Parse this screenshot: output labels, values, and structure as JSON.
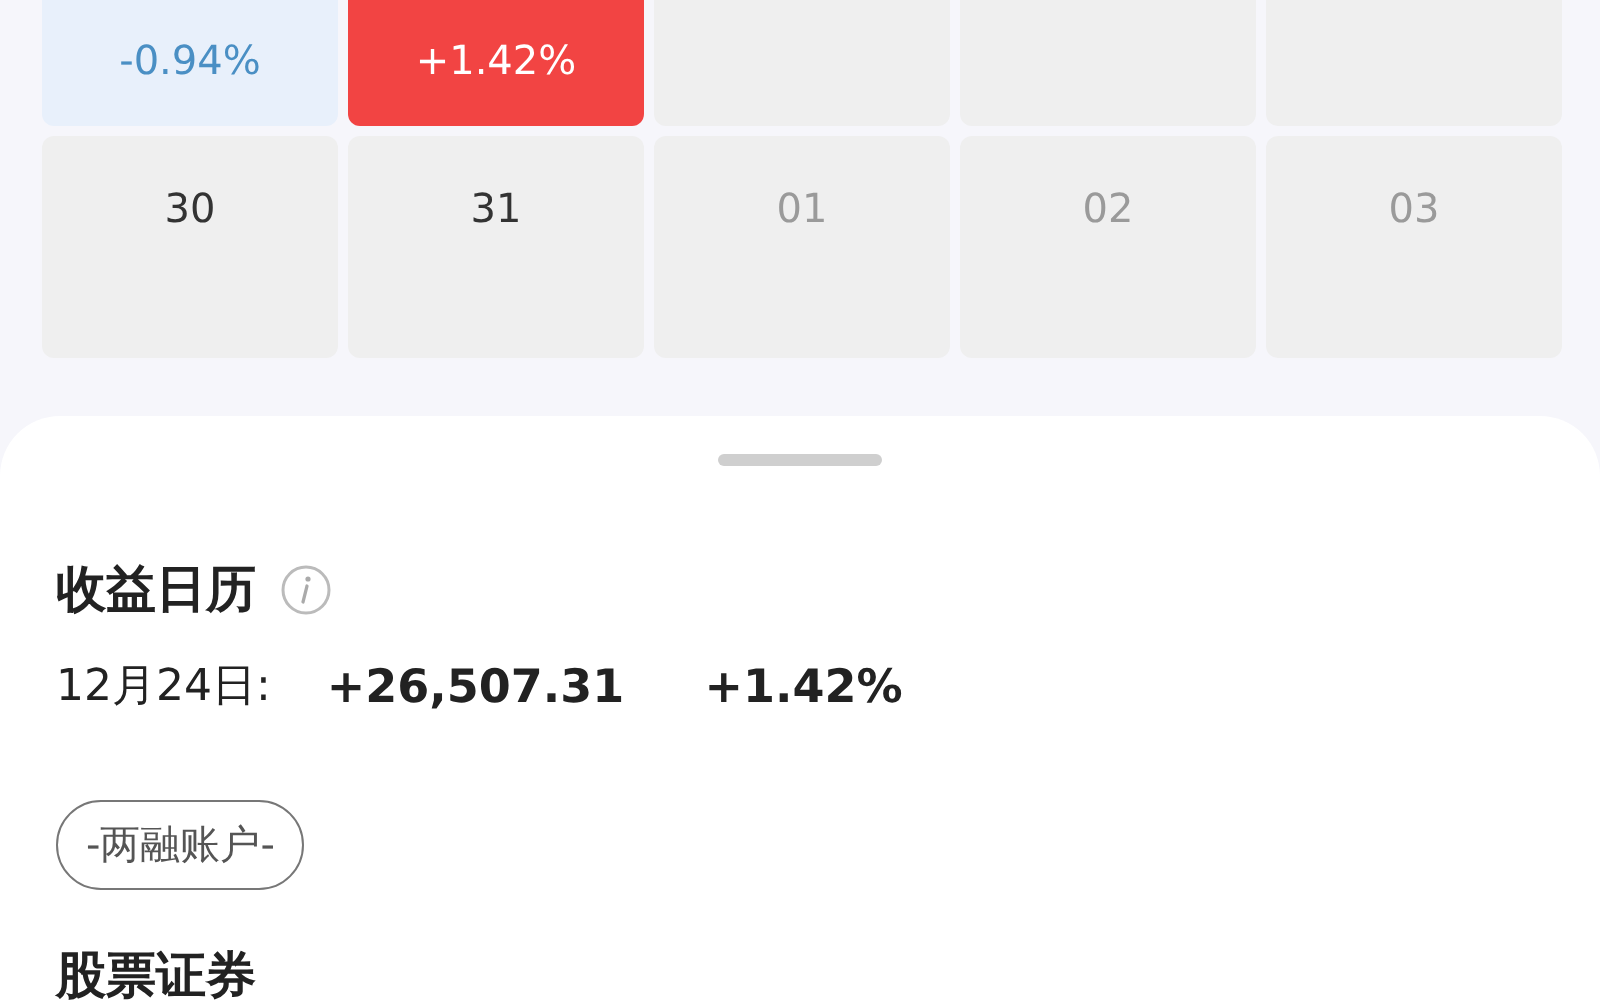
{
  "calendar": {
    "rows": [
      [
        {
          "kind": "loss",
          "text": "-0.94%"
        },
        {
          "kind": "gain",
          "text": "+1.42%"
        },
        {
          "kind": "empty"
        },
        {
          "kind": "empty"
        },
        {
          "kind": "empty"
        }
      ],
      [
        {
          "kind": "past",
          "text": "30"
        },
        {
          "kind": "past",
          "text": "31"
        },
        {
          "kind": "future",
          "text": "01"
        },
        {
          "kind": "future",
          "text": "02"
        },
        {
          "kind": "future",
          "text": "03"
        }
      ]
    ]
  },
  "sheet": {
    "title": "收益日历",
    "date": "12月24日:",
    "amount": "+26,507.31",
    "percent": "+1.42%",
    "account_chip": "-两融账户-",
    "next_section_title": "股票证券"
  }
}
